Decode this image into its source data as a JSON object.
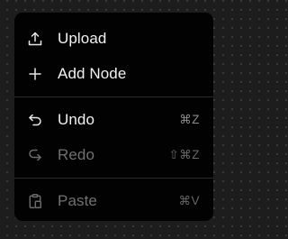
{
  "context_menu": {
    "items": [
      {
        "label": "Upload",
        "icon": "upload-icon",
        "shortcut": "",
        "enabled": true
      },
      {
        "label": "Add Node",
        "icon": "plus-icon",
        "shortcut": "",
        "enabled": true
      },
      {
        "label": "Undo",
        "icon": "undo-icon",
        "shortcut": "⌘Z",
        "enabled": true
      },
      {
        "label": "Redo",
        "icon": "redo-icon",
        "shortcut": "⇧⌘Z",
        "enabled": false
      },
      {
        "label": "Paste",
        "icon": "paste-icon",
        "shortcut": "⌘V",
        "enabled": false
      }
    ]
  },
  "colors": {
    "canvas_background": "#1d1d1d",
    "canvas_dots": "#3c3c3c",
    "menu_background": "#020202",
    "text_enabled": "#f2f2f2",
    "text_disabled": "#717171",
    "shortcut_text": "#8a8a8a",
    "divider": "#2a2a2a"
  }
}
